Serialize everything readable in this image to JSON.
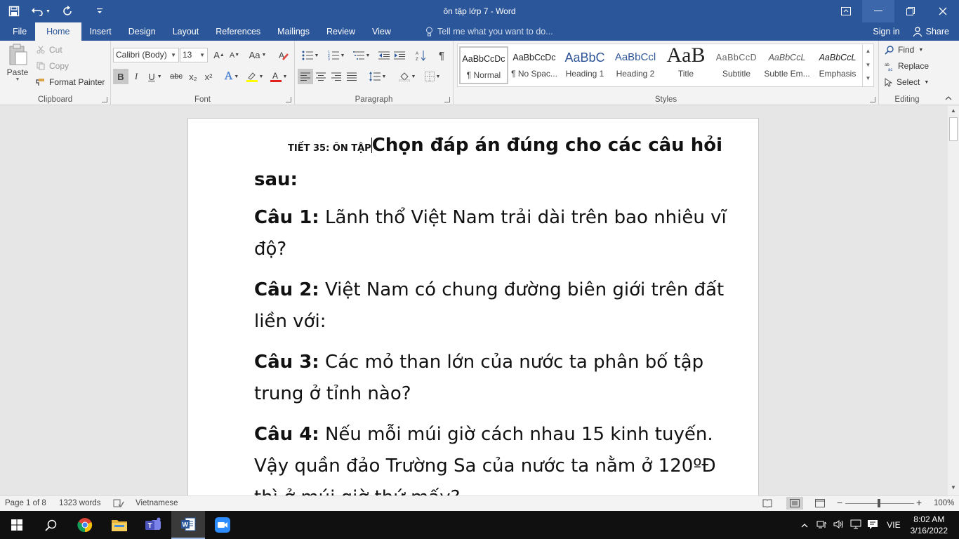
{
  "window": {
    "title": "ôn tập lớp 7 - Word",
    "accent": "#2b579a"
  },
  "qat": {
    "save_icon": "save-icon",
    "undo_icon": "undo-icon",
    "redo_icon": "redo-icon",
    "customize_icon": "customize-qat-icon"
  },
  "tabs": [
    {
      "label": "File"
    },
    {
      "label": "Home"
    },
    {
      "label": "Insert"
    },
    {
      "label": "Design"
    },
    {
      "label": "Layout"
    },
    {
      "label": "References"
    },
    {
      "label": "Mailings"
    },
    {
      "label": "Review"
    },
    {
      "label": "View"
    }
  ],
  "tell_me": "Tell me what you want to do...",
  "sign_in": "Sign in",
  "share": "Share",
  "clipboard": {
    "paste": "Paste",
    "cut": "Cut",
    "copy": "Copy",
    "format_painter": "Format Painter",
    "label": "Clipboard"
  },
  "font": {
    "name": "Calibri (Body)",
    "size": "13",
    "label": "Font",
    "bold": "B",
    "italic": "I",
    "underline": "U",
    "strike": "abc",
    "subscript": "x₂",
    "superscript": "x²"
  },
  "paragraph": {
    "label": "Paragraph"
  },
  "styles": {
    "label": "Styles",
    "items": [
      {
        "sample": "AaBbCcDc",
        "name": "¶ Normal"
      },
      {
        "sample": "AaBbCcDc",
        "name": "¶ No Spac..."
      },
      {
        "sample": "AaBbC",
        "name": "Heading 1"
      },
      {
        "sample": "AaBbCcl",
        "name": "Heading 2"
      },
      {
        "sample": "AaB",
        "name": "Title"
      },
      {
        "sample": "AaBbCcD",
        "name": "Subtitle"
      },
      {
        "sample": "AaBbCcL",
        "name": "Subtle Em..."
      },
      {
        "sample": "AaBbCcL",
        "name": "Emphasis"
      }
    ]
  },
  "editing": {
    "label": "Editing",
    "find": "Find",
    "replace": "Replace",
    "select": "Select"
  },
  "document": {
    "heading_small": "TIẾT 35: ÔN TẬP",
    "heading_big": "Chọn đáp án đúng cho các câu hỏi sau:",
    "questions": [
      {
        "label": "Câu 1:",
        "text": " Lãnh thổ Việt Nam trải dài trên bao nhiêu vĩ độ?"
      },
      {
        "label": "Câu 2:",
        "text": " Việt Nam có chung đường biên giới trên đất liền với:"
      },
      {
        "label": "Câu 3:",
        "text": " Các mỏ than lớn của nước ta phân bố tập trung ở tỉnh nào?"
      },
      {
        "label": "Câu 4:",
        "text": " Nếu mỗi múi giờ cách nhau 15 kinh tuyến. Vậy quần đảo Trường Sa của nước ta nằm ở 120ºĐ thì ở múi giờ thứ mấy?"
      }
    ]
  },
  "status": {
    "page": "Page 1 of 8",
    "words": "1323 words",
    "language": "Vietnamese",
    "zoom": "100%"
  },
  "taskbar": {
    "language": "VIE",
    "time": "8:02 AM",
    "date": "3/16/2022"
  }
}
